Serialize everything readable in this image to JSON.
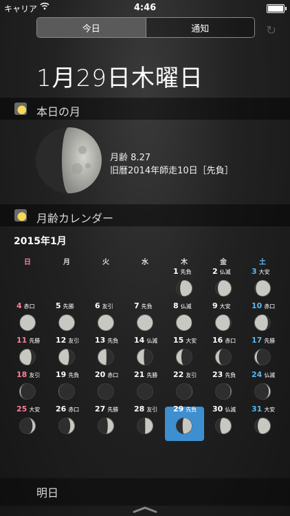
{
  "statusbar": {
    "carrier": "キャリア",
    "time": "4:46"
  },
  "segment": {
    "today": "今日",
    "notifications": "通知"
  },
  "date_title": "1月29日木曜日",
  "moon_section": {
    "title": "本日の月",
    "age_line": "月齢 8.27",
    "lunar_line": "旧暦2014年師走10日［先負］"
  },
  "calendar_section": {
    "title": "月齢カレンダー",
    "month": "2015年1月",
    "weekdays": [
      "日",
      "月",
      "火",
      "水",
      "木",
      "金",
      "土"
    ],
    "days": [
      {
        "d": "1",
        "r": "先負"
      },
      {
        "d": "2",
        "r": "仏滅"
      },
      {
        "d": "3",
        "r": "大安"
      },
      {
        "d": "4",
        "r": "赤口"
      },
      {
        "d": "5",
        "r": "先勝"
      },
      {
        "d": "6",
        "r": "友引"
      },
      {
        "d": "7",
        "r": "先負"
      },
      {
        "d": "8",
        "r": "仏滅"
      },
      {
        "d": "9",
        "r": "大安"
      },
      {
        "d": "10",
        "r": "赤口"
      },
      {
        "d": "11",
        "r": "先勝"
      },
      {
        "d": "12",
        "r": "友引"
      },
      {
        "d": "13",
        "r": "先負"
      },
      {
        "d": "14",
        "r": "仏滅"
      },
      {
        "d": "15",
        "r": "大安"
      },
      {
        "d": "16",
        "r": "赤口"
      },
      {
        "d": "17",
        "r": "先勝"
      },
      {
        "d": "18",
        "r": "友引"
      },
      {
        "d": "19",
        "r": "先負"
      },
      {
        "d": "20",
        "r": "赤口"
      },
      {
        "d": "21",
        "r": "先勝"
      },
      {
        "d": "22",
        "r": "友引"
      },
      {
        "d": "23",
        "r": "先負"
      },
      {
        "d": "24",
        "r": "仏滅"
      },
      {
        "d": "25",
        "r": "大安"
      },
      {
        "d": "26",
        "r": "赤口"
      },
      {
        "d": "27",
        "r": "先勝"
      },
      {
        "d": "28",
        "r": "友引"
      },
      {
        "d": "29",
        "r": "先負"
      },
      {
        "d": "30",
        "r": "仏滅"
      },
      {
        "d": "31",
        "r": "大安"
      }
    ],
    "selected_day": "29"
  },
  "tomorrow": {
    "label": "明日"
  },
  "colors": {
    "sunday": "#ff7e9a",
    "saturday": "#5ab8f0",
    "selected": "#3d8fd0"
  }
}
